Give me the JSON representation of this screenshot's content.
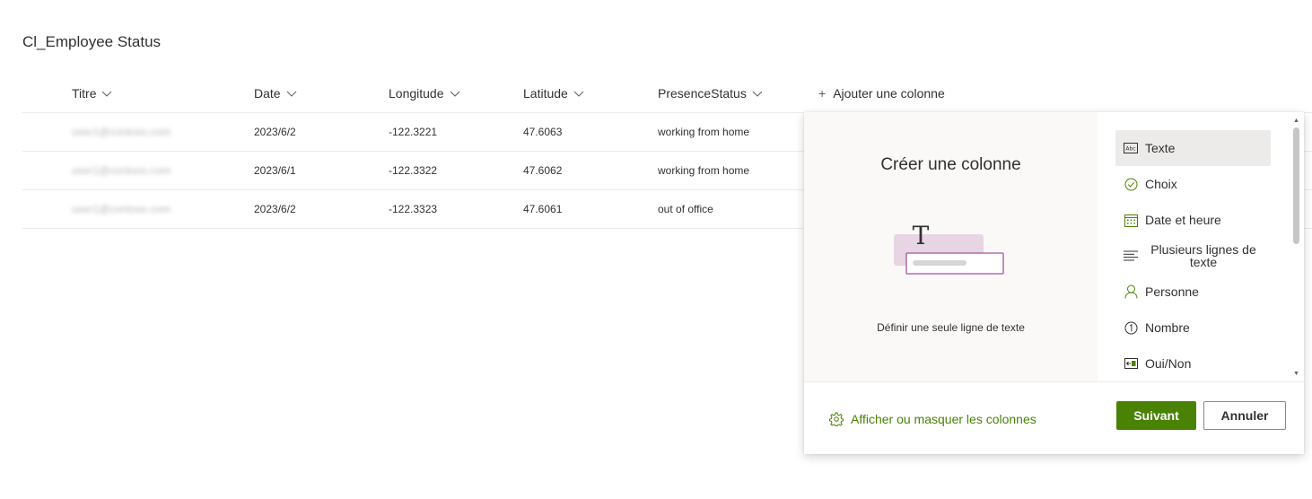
{
  "list": {
    "title": "Cl_Employee Status"
  },
  "columns": [
    {
      "label": "Titre"
    },
    {
      "label": "Date"
    },
    {
      "label": "Longitude"
    },
    {
      "label": "Latitude"
    },
    {
      "label": "PresenceStatus"
    }
  ],
  "add_column_label": "Ajouter une colonne",
  "rows": [
    {
      "titre": "user1@contoso.com",
      "date": "2023/6/2",
      "longitude": "-122.3221",
      "latitude": "47.6063",
      "presence": "working from home"
    },
    {
      "titre": "user1@contoso.com",
      "date": "2023/6/1",
      "longitude": "-122.3322",
      "latitude": "47.6062",
      "presence": "working from home"
    },
    {
      "titre": "user1@contoso.com",
      "date": "2023/6/2",
      "longitude": "-122.3323",
      "latitude": "47.6061",
      "presence": "out of office"
    }
  ],
  "panel": {
    "title": "Créer une colonne",
    "description": "Définir une seule ligne de texte",
    "types": [
      {
        "label": "Texte",
        "icon": "text-icon",
        "selected": true
      },
      {
        "label": "Choix",
        "icon": "choice-check-icon"
      },
      {
        "label": "Date et heure",
        "icon": "calendar-icon"
      },
      {
        "label": "Plusieurs lignes de texte",
        "icon": "multiline-text-icon"
      },
      {
        "label": "Personne",
        "icon": "person-icon"
      },
      {
        "label": "Nombre",
        "icon": "number-icon"
      },
      {
        "label": "Oui/Non",
        "icon": "yes-no-toggle-icon"
      }
    ],
    "show_hide_label": "Afficher ou masquer les colonnes",
    "next_label": "Suivant",
    "cancel_label": "Annuler"
  },
  "colors": {
    "accent": "#498205",
    "selected_bg": "#edebe9",
    "preview_bg": "#faf9f8"
  }
}
